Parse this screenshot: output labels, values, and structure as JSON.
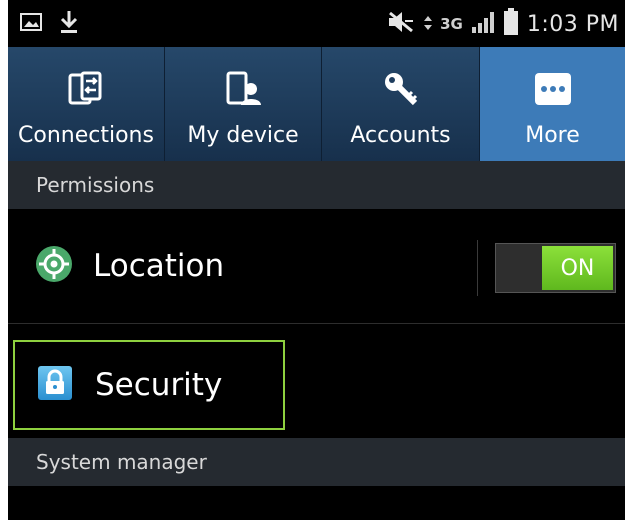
{
  "status_bar": {
    "network": "3G",
    "time": "1:03 PM",
    "icons": [
      "image-icon",
      "download-icon",
      "mute-icon",
      "data-arrows-icon",
      "signal-icon",
      "battery-icon"
    ]
  },
  "tabs": [
    {
      "label": "Connections",
      "icon": "connections-icon",
      "active": false
    },
    {
      "label": "My device",
      "icon": "my-device-icon",
      "active": false
    },
    {
      "label": "Accounts",
      "icon": "accounts-key-icon",
      "active": false
    },
    {
      "label": "More",
      "icon": "more-dots-icon",
      "active": true
    }
  ],
  "sections": {
    "permissions": "Permissions",
    "system_manager": "System manager"
  },
  "location": {
    "label": "Location",
    "toggle_text": "ON",
    "toggle_on": true
  },
  "security": {
    "label": "Security",
    "highlighted": true
  },
  "colors": {
    "tab_active": "#3d7bb8",
    "tab_inactive": "#1b3550",
    "toggle_on": "#6ccb2a",
    "highlight_border": "#8ed03f",
    "section_header": "#252a30"
  }
}
